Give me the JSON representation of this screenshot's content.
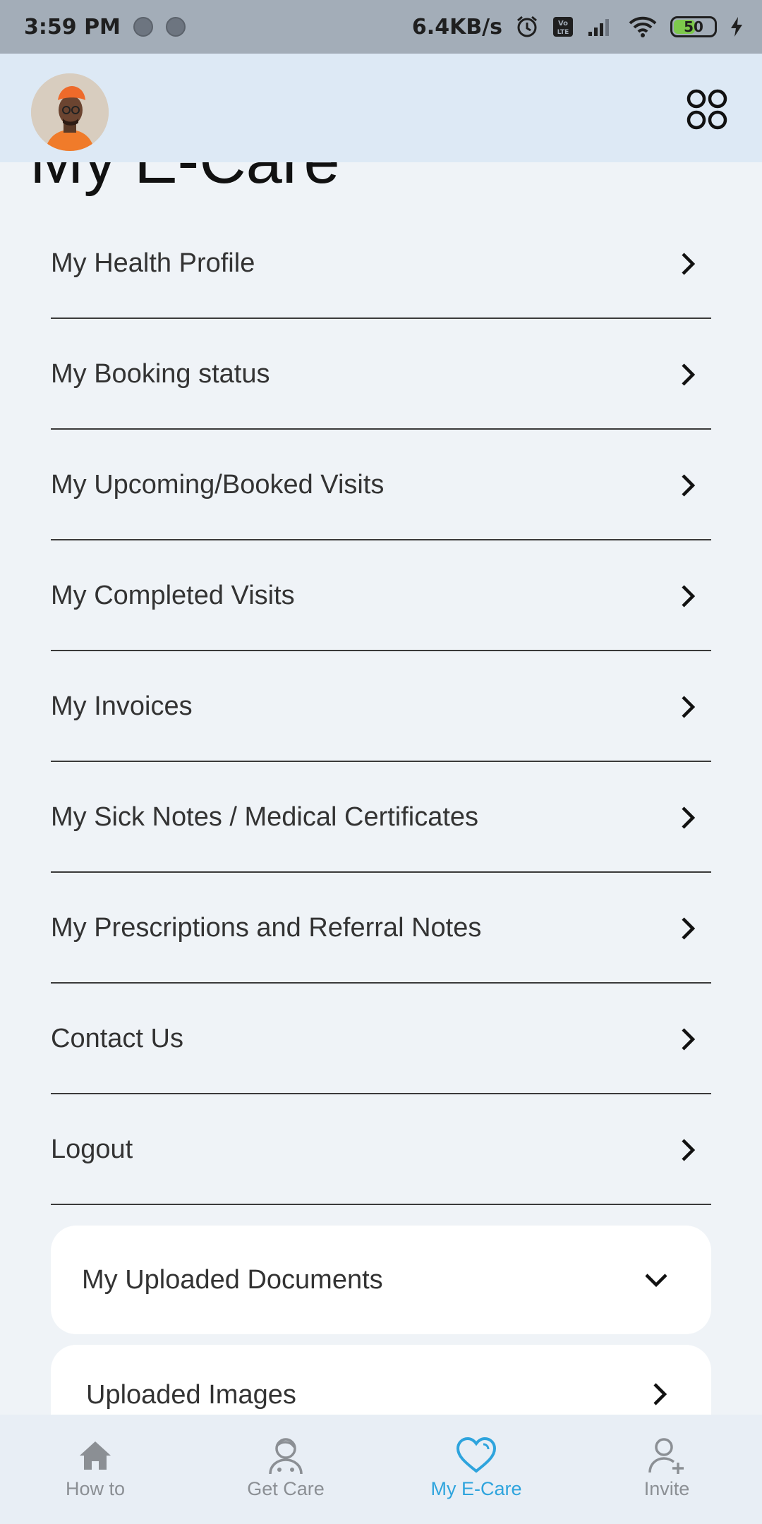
{
  "status_bar": {
    "time": "3:59 PM",
    "speed": "6.4KB/s",
    "battery": "50"
  },
  "header": {
    "title": "My E-Care"
  },
  "menu": {
    "items": [
      {
        "label": "My Health Profile"
      },
      {
        "label": "My Booking status"
      },
      {
        "label": "My Upcoming/Booked Visits"
      },
      {
        "label": "My Completed Visits"
      },
      {
        "label": "My Invoices"
      },
      {
        "label": "My Sick Notes / Medical Certificates"
      },
      {
        "label": "My Prescriptions and Referral Notes"
      },
      {
        "label": "Contact Us"
      },
      {
        "label": "Logout"
      }
    ]
  },
  "documents": {
    "header_label": "My Uploaded Documents",
    "images_label": "Uploaded Images"
  },
  "bottom_nav": {
    "items": [
      {
        "label": "How to",
        "icon": "home-icon"
      },
      {
        "label": "Get Care",
        "icon": "doctor-icon"
      },
      {
        "label": "My E-Care",
        "icon": "heart-icon"
      },
      {
        "label": "Invite",
        "icon": "add-user-icon"
      }
    ],
    "active_index": 2,
    "active_color": "#2ea4dd",
    "inactive_color": "#8b8f94"
  }
}
